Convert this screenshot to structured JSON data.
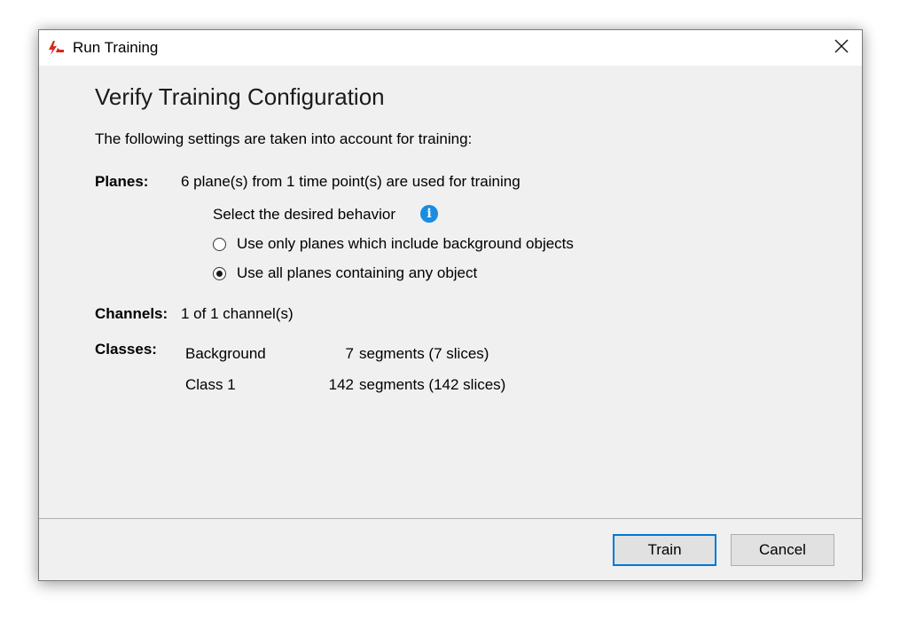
{
  "window": {
    "title": "Run Training",
    "icon": "red-lightning-logo-icon"
  },
  "main": {
    "heading": "Verify Training Configuration",
    "intro": "The following settings are taken into account for training:",
    "planes": {
      "label": "Planes:",
      "value": "6 plane(s) from 1 time point(s) are used for training",
      "behavior_label": "Select the desired behavior",
      "options": [
        {
          "label": "Use only planes which include background objects",
          "selected": false
        },
        {
          "label": "Use all planes containing any object",
          "selected": true
        }
      ]
    },
    "channels": {
      "label": "Channels:",
      "value": "1 of 1 channel(s)"
    },
    "classes": {
      "label": "Classes:",
      "rows": [
        {
          "name": "Background",
          "count": "7",
          "detail": "segments (7 slices)"
        },
        {
          "name": "Class 1",
          "count": "142",
          "detail": "segments (142 slices)"
        }
      ]
    }
  },
  "footer": {
    "train_label": "Train",
    "cancel_label": "Cancel"
  },
  "colors": {
    "accent": "#0078d7",
    "info": "#1a8ce0",
    "logo_red": "#d9281e"
  }
}
